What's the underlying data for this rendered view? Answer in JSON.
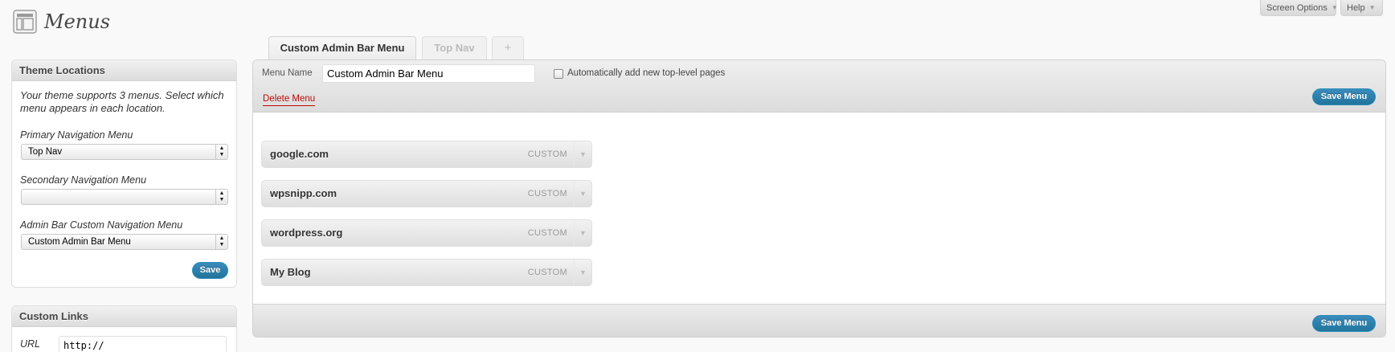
{
  "header": {
    "title": "Menus",
    "screen_options": "Screen Options",
    "help": "Help"
  },
  "theme_locations": {
    "heading": "Theme Locations",
    "description": "Your theme supports 3 menus. Select which menu appears in each location.",
    "locations": [
      {
        "label": "Primary Navigation Menu",
        "value": "Top Nav"
      },
      {
        "label": "Secondary Navigation Menu",
        "value": ""
      },
      {
        "label": "Admin Bar Custom Navigation Menu",
        "value": "Custom Admin Bar Menu"
      }
    ],
    "save_label": "Save"
  },
  "custom_links": {
    "heading": "Custom Links",
    "url_label": "URL",
    "url_value": "http://"
  },
  "tabs": [
    {
      "label": "Custom Admin Bar Menu",
      "active": true
    },
    {
      "label": "Top Nav",
      "active": false
    },
    {
      "label": "+",
      "active": false
    }
  ],
  "menu_editor": {
    "name_label": "Menu Name",
    "name_value": "Custom Admin Bar Menu",
    "auto_add_label": "Automatically add new top-level pages",
    "auto_add_checked": false,
    "delete_label": "Delete Menu",
    "save_label": "Save Menu",
    "items": [
      {
        "title": "google.com",
        "type": "CUSTOM"
      },
      {
        "title": "wpsnipp.com",
        "type": "CUSTOM"
      },
      {
        "title": "wordpress.org",
        "type": "CUSTOM"
      },
      {
        "title": "My Blog",
        "type": "CUSTOM"
      }
    ]
  },
  "colors": {
    "accent_button": "#21759b",
    "delete_link": "#bc0b0b",
    "background": "#f9f9f9"
  },
  "icons": {
    "page_icon": "menus-icon",
    "dropdown": "chevron-down-icon",
    "select_arrows": "select-arrows-icon"
  }
}
